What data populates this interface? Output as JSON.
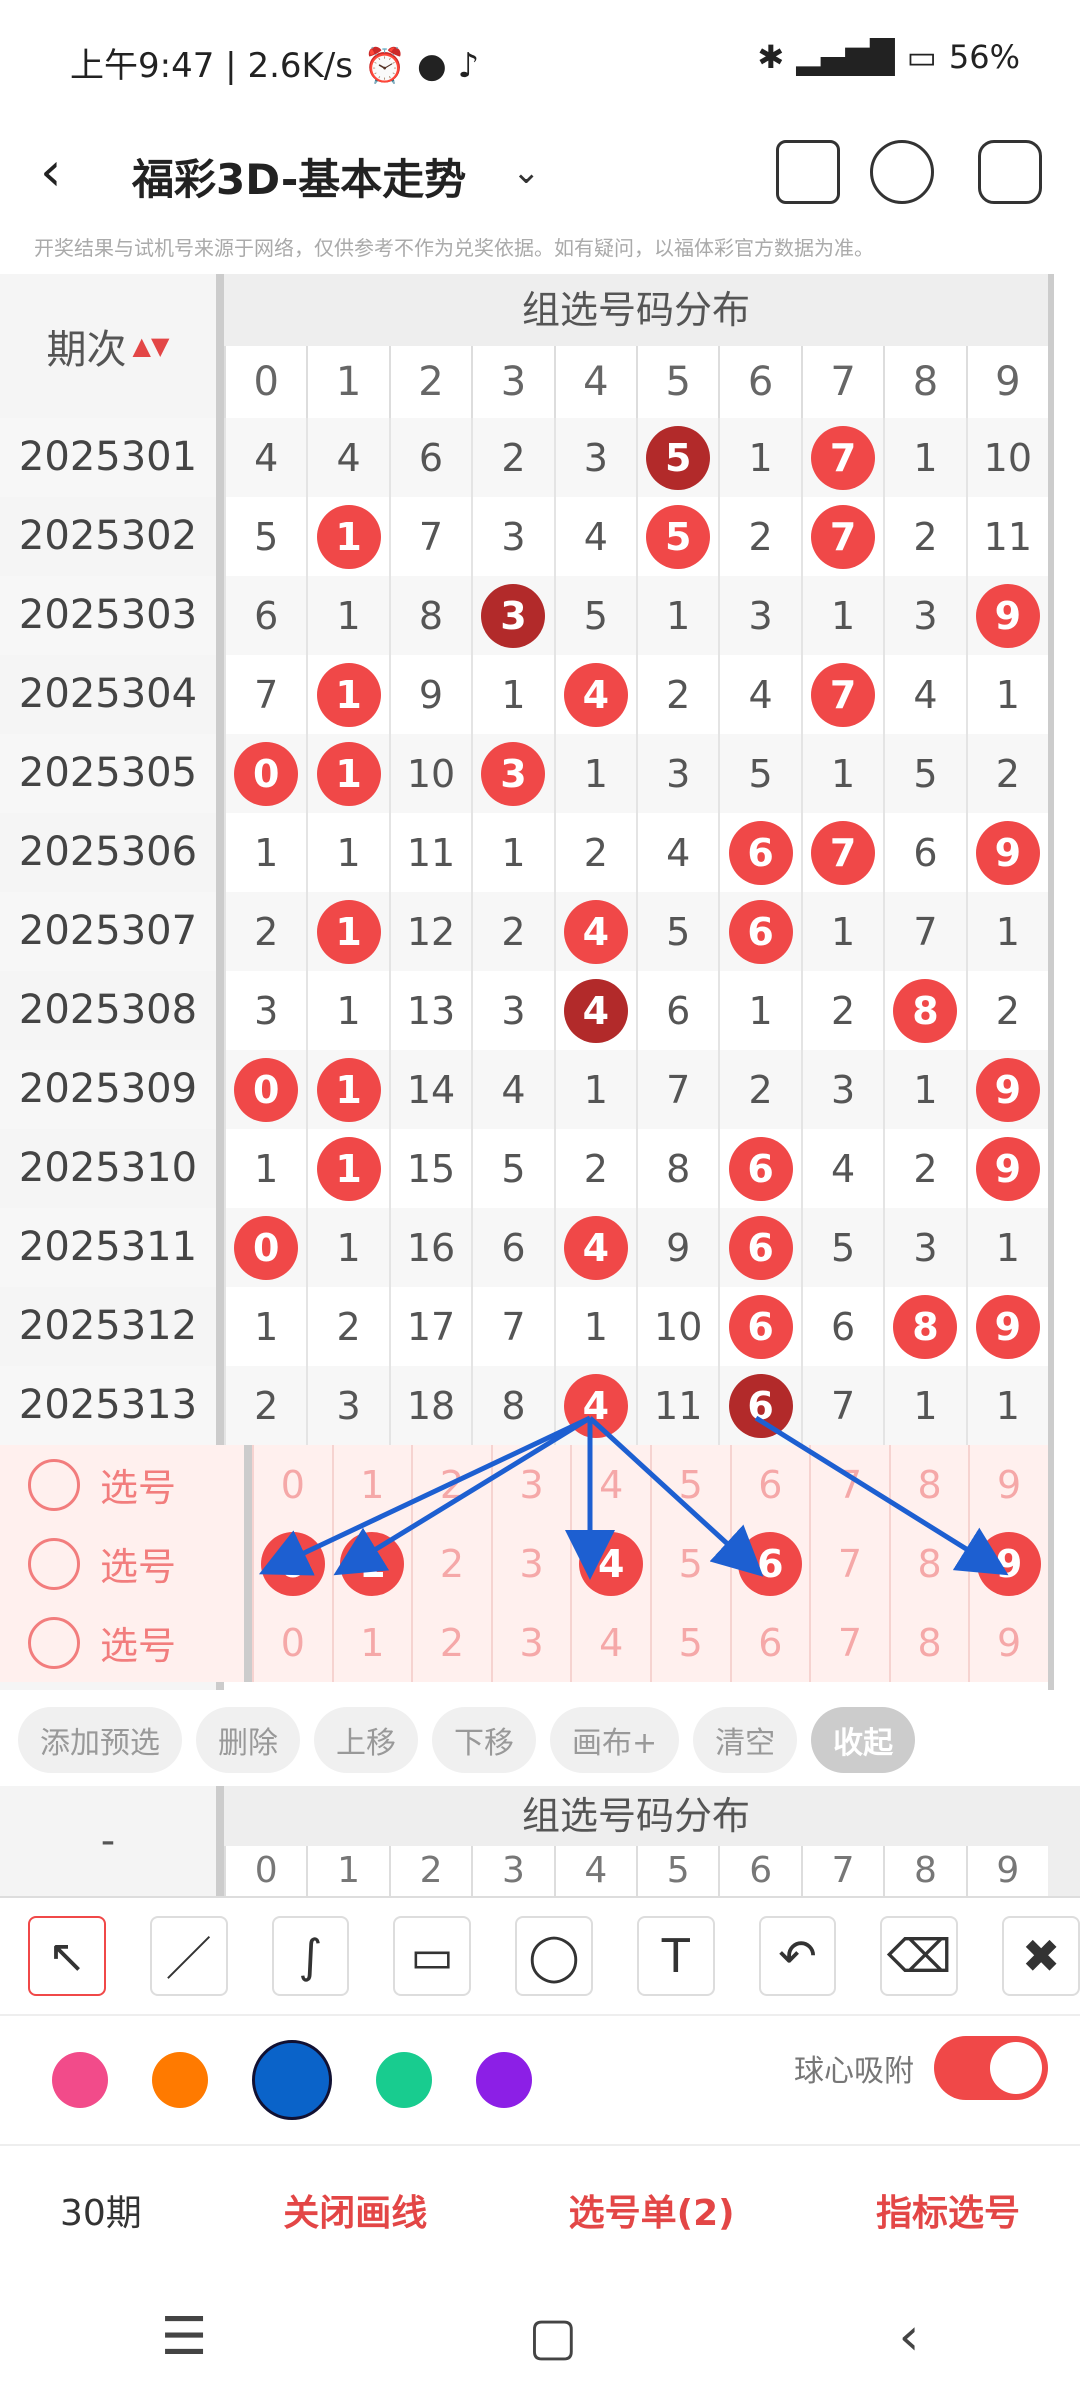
{
  "status": {
    "time": "上午9:47",
    "speed": "2.6K/s",
    "battery": "56%"
  },
  "header": {
    "title": "福彩3D-基本走势",
    "notice": "开奖结果与试机号来源于网络，仅供参考不作为兑奖依据。如有疑问，以福体彩官方数据为准。"
  },
  "grid": {
    "title": "组选号码分布",
    "period_label": "期次",
    "columns": [
      "0",
      "1",
      "2",
      "3",
      "4",
      "5",
      "6",
      "7",
      "8",
      "9"
    ],
    "rows": [
      {
        "period": "2025301",
        "cells": [
          "4",
          "4",
          "6",
          "2",
          "3",
          "5",
          "1",
          "7",
          "1",
          "10"
        ],
        "balls": [
          5,
          7
        ],
        "dark": [
          5
        ]
      },
      {
        "period": "2025302",
        "cells": [
          "5",
          "1",
          "7",
          "3",
          "4",
          "5",
          "2",
          "7",
          "2",
          "11"
        ],
        "balls": [
          1,
          5,
          7
        ],
        "dark": []
      },
      {
        "period": "2025303",
        "cells": [
          "6",
          "1",
          "8",
          "3",
          "5",
          "1",
          "3",
          "1",
          "3",
          "9"
        ],
        "balls": [
          3,
          9
        ],
        "dark": [
          3
        ]
      },
      {
        "period": "2025304",
        "cells": [
          "7",
          "1",
          "9",
          "1",
          "4",
          "2",
          "4",
          "7",
          "4",
          "1"
        ],
        "balls": [
          1,
          4,
          7
        ],
        "dark": []
      },
      {
        "period": "2025305",
        "cells": [
          "0",
          "1",
          "10",
          "3",
          "1",
          "3",
          "5",
          "1",
          "5",
          "2"
        ],
        "balls": [
          0,
          1,
          3
        ],
        "dark": []
      },
      {
        "period": "2025306",
        "cells": [
          "1",
          "1",
          "11",
          "1",
          "2",
          "4",
          "6",
          "7",
          "6",
          "9"
        ],
        "balls": [
          6,
          7,
          9
        ],
        "dark": []
      },
      {
        "period": "2025307",
        "cells": [
          "2",
          "1",
          "12",
          "2",
          "4",
          "5",
          "6",
          "1",
          "7",
          "1"
        ],
        "balls": [
          1,
          4,
          6
        ],
        "dark": []
      },
      {
        "period": "2025308",
        "cells": [
          "3",
          "1",
          "13",
          "3",
          "4",
          "6",
          "1",
          "2",
          "8",
          "2"
        ],
        "balls": [
          4,
          8
        ],
        "dark": [
          4
        ]
      },
      {
        "period": "2025309",
        "cells": [
          "0",
          "1",
          "14",
          "4",
          "1",
          "7",
          "2",
          "3",
          "1",
          "9"
        ],
        "balls": [
          0,
          1,
          9
        ],
        "dark": []
      },
      {
        "period": "2025310",
        "cells": [
          "1",
          "1",
          "15",
          "5",
          "2",
          "8",
          "6",
          "4",
          "2",
          "9"
        ],
        "balls": [
          1,
          6,
          9
        ],
        "dark": []
      },
      {
        "period": "2025311",
        "cells": [
          "0",
          "1",
          "16",
          "6",
          "4",
          "9",
          "6",
          "5",
          "3",
          "1"
        ],
        "balls": [
          0,
          4,
          6
        ],
        "dark": []
      },
      {
        "period": "2025312",
        "cells": [
          "1",
          "2",
          "17",
          "7",
          "1",
          "10",
          "6",
          "6",
          "8",
          "9"
        ],
        "balls": [
          6,
          8,
          9
        ],
        "dark": []
      },
      {
        "period": "2025313",
        "cells": [
          "2",
          "3",
          "18",
          "8",
          "4",
          "11",
          "6",
          "7",
          "1",
          "1"
        ],
        "balls": [
          4,
          6
        ],
        "dark": [
          6
        ]
      }
    ],
    "select_rows": [
      {
        "label": "选号",
        "cells": [
          "0",
          "1",
          "2",
          "3",
          "4",
          "5",
          "6",
          "7",
          "8",
          "9"
        ],
        "balls": []
      },
      {
        "label": "选号",
        "cells": [
          "0",
          "1",
          "2",
          "3",
          "4",
          "5",
          "6",
          "7",
          "8",
          "9"
        ],
        "balls": [
          0,
          1,
          4,
          6,
          9
        ]
      },
      {
        "label": "选号",
        "cells": [
          "0",
          "1",
          "2",
          "3",
          "4",
          "5",
          "6",
          "7",
          "8",
          "9"
        ],
        "balls": []
      }
    ]
  },
  "actions": [
    "添加预选",
    "删除",
    "上移",
    "下移",
    "画布+",
    "清空",
    "收起"
  ],
  "lower": {
    "left": "-",
    "title": "组选号码分布",
    "columns": [
      "0",
      "1",
      "2",
      "3",
      "4",
      "5",
      "6",
      "7",
      "8",
      "9"
    ]
  },
  "tools": [
    "arrow-tool",
    "line-tool",
    "curve-tool",
    "rect-tool",
    "circle-tool",
    "text-tool",
    "undo-tool",
    "eraser-tool",
    "clear-tool"
  ],
  "palette": [
    "#f24b8a",
    "#ff7a00",
    "#0a63c9",
    "#18cc8f",
    "#8c1fe6"
  ],
  "snap_label": "球心吸附",
  "bottom": {
    "period": "30期",
    "close_lines": "关闭画线",
    "selection_list": "选号单(2)",
    "indicator_pick": "指标选号"
  }
}
